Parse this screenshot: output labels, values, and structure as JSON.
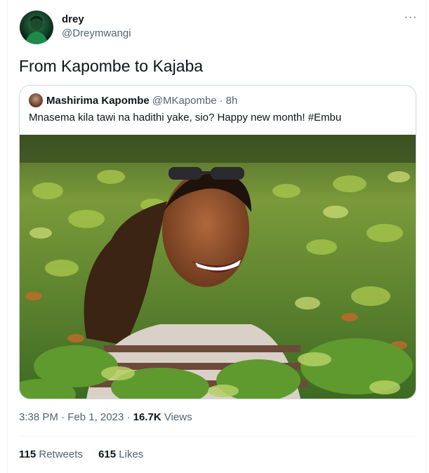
{
  "author": {
    "name": "drey",
    "handle": "@Dreymwangi"
  },
  "menu": {
    "more_icon": "more-dots-icon",
    "label": "···"
  },
  "tweet": {
    "text": "From Kapombe to Kajaba"
  },
  "quoted": {
    "name": "Mashirima Kapombe",
    "handle": "@MKapombe",
    "separator": "·",
    "time": "8h",
    "text": "Mnasema kila tawi na hadithi yake, sio? Happy new month! #Embu"
  },
  "meta": {
    "time": "3:38 PM",
    "separator": "·",
    "date": "Feb 1, 2023",
    "views_count": "16.7K",
    "views_label": "Views"
  },
  "stats": {
    "retweets_count": "115",
    "retweets_label": "Retweets",
    "likes_count": "615",
    "likes_label": "Likes"
  },
  "colors": {
    "text": "#0f1419",
    "secondary": "#536471",
    "border": "#cfd9de"
  }
}
